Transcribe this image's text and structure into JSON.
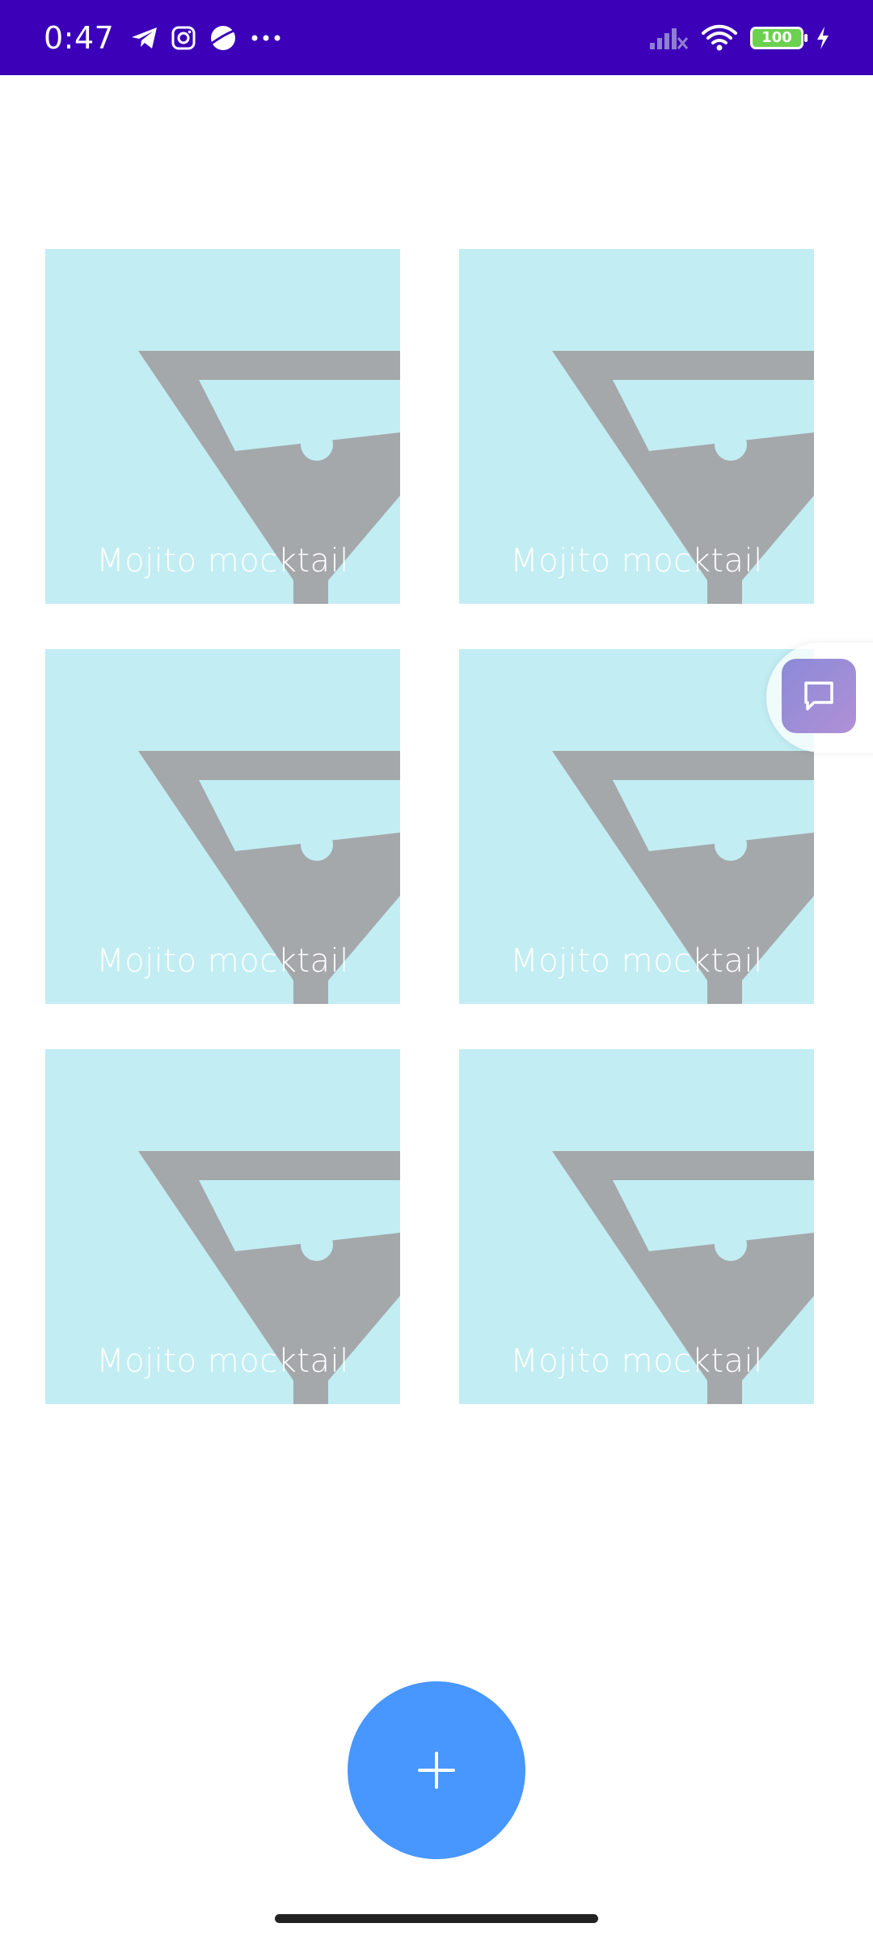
{
  "status_bar": {
    "time": "0:47",
    "battery": "100",
    "icons": [
      "telegram-icon",
      "instagram-icon",
      "planet-icon",
      "more-dots-icon",
      "signal-icon",
      "wifi-icon",
      "battery-icon",
      "charging-icon"
    ]
  },
  "grid": {
    "items": [
      {
        "label": "Mojito mocktail"
      },
      {
        "label": "Mojito mocktail"
      },
      {
        "label": "Mojito mocktail"
      },
      {
        "label": "Mojito mocktail"
      },
      {
        "label": "Mojito mocktail"
      },
      {
        "label": "Mojito mocktail"
      }
    ]
  },
  "floating_chat": {
    "icon": "chat-icon"
  },
  "fab": {
    "icon": "plus-icon"
  },
  "colors": {
    "status_bar_bg": "#3b00b8",
    "tile_bg": "#c2edf3",
    "glass_icon": "#a4a8ab",
    "fab_bg": "#4896ff",
    "chat_button": "#9a8cd8"
  }
}
